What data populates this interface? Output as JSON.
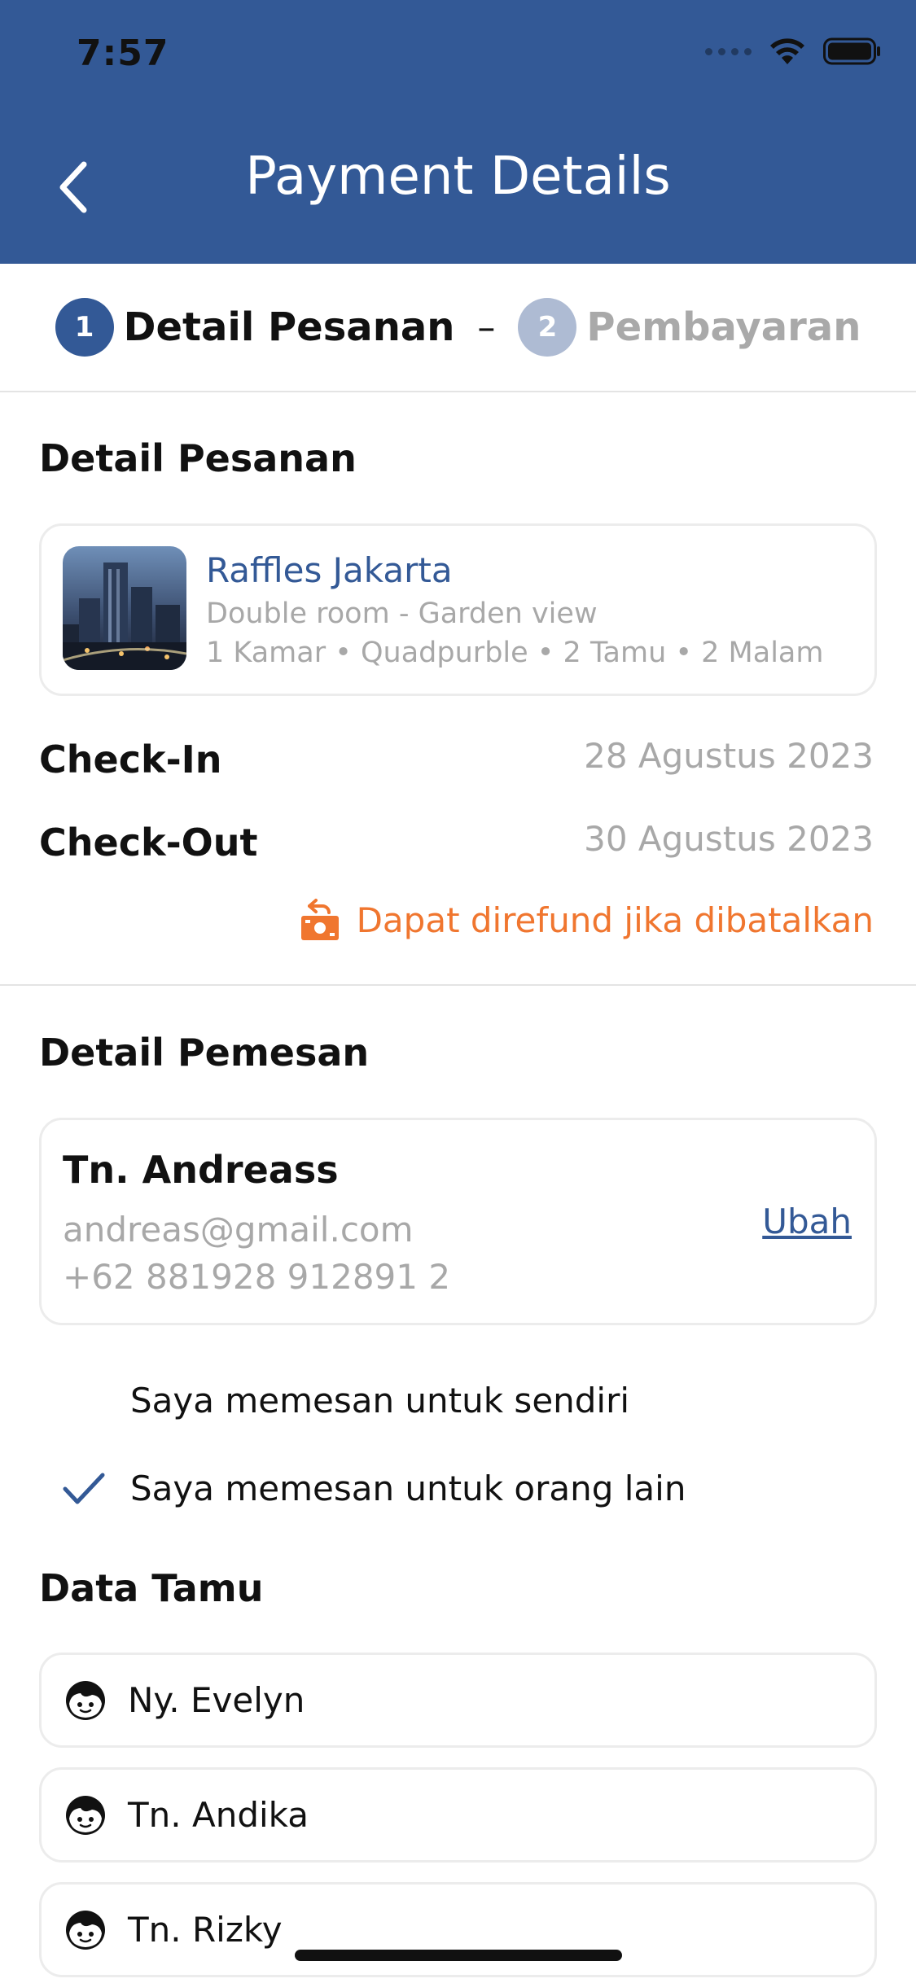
{
  "status_bar": {
    "time": "7:57"
  },
  "header": {
    "title": "Payment Details",
    "back_icon": "chevron-left-icon"
  },
  "stepper": {
    "steps": [
      {
        "number": "1",
        "label": "Detail Pesanan",
        "active": true
      },
      {
        "number": "2",
        "label": "Pembayaran",
        "active": false
      }
    ],
    "separator": "–"
  },
  "order_detail": {
    "section_title": "Detail Pesanan",
    "hotel": {
      "name": "Raffles Jakarta",
      "room": "Double room - Garden view",
      "meta": "1 Kamar • Quadpurble • 2 Tamu • 2 Malam"
    },
    "check_in": {
      "label": "Check-In",
      "value": "28 Agustus 2023"
    },
    "check_out": {
      "label": "Check-Out",
      "value": "30 Agustus 2023"
    },
    "refund_note": "Dapat direfund jika dibatalkan"
  },
  "orderer_detail": {
    "section_title": "Detail Pemesan",
    "name": "Tn. Andreass",
    "email": "andreas@gmail.com",
    "phone": "+62 881928 912891 2",
    "change_label": "Ubah"
  },
  "booking_options": [
    {
      "label": "Saya memesan untuk sendiri",
      "checked": false
    },
    {
      "label": "Saya memesan untuk orang lain",
      "checked": true
    }
  ],
  "guests": {
    "section_title": "Data Tamu",
    "items": [
      {
        "name": "Ny. Evelyn"
      },
      {
        "name": "Tn. Andika"
      },
      {
        "name": "Tn. Rizky"
      }
    ]
  },
  "colors": {
    "primary": "#335996",
    "accent": "#f0762f",
    "muted": "#a8a8a8"
  }
}
